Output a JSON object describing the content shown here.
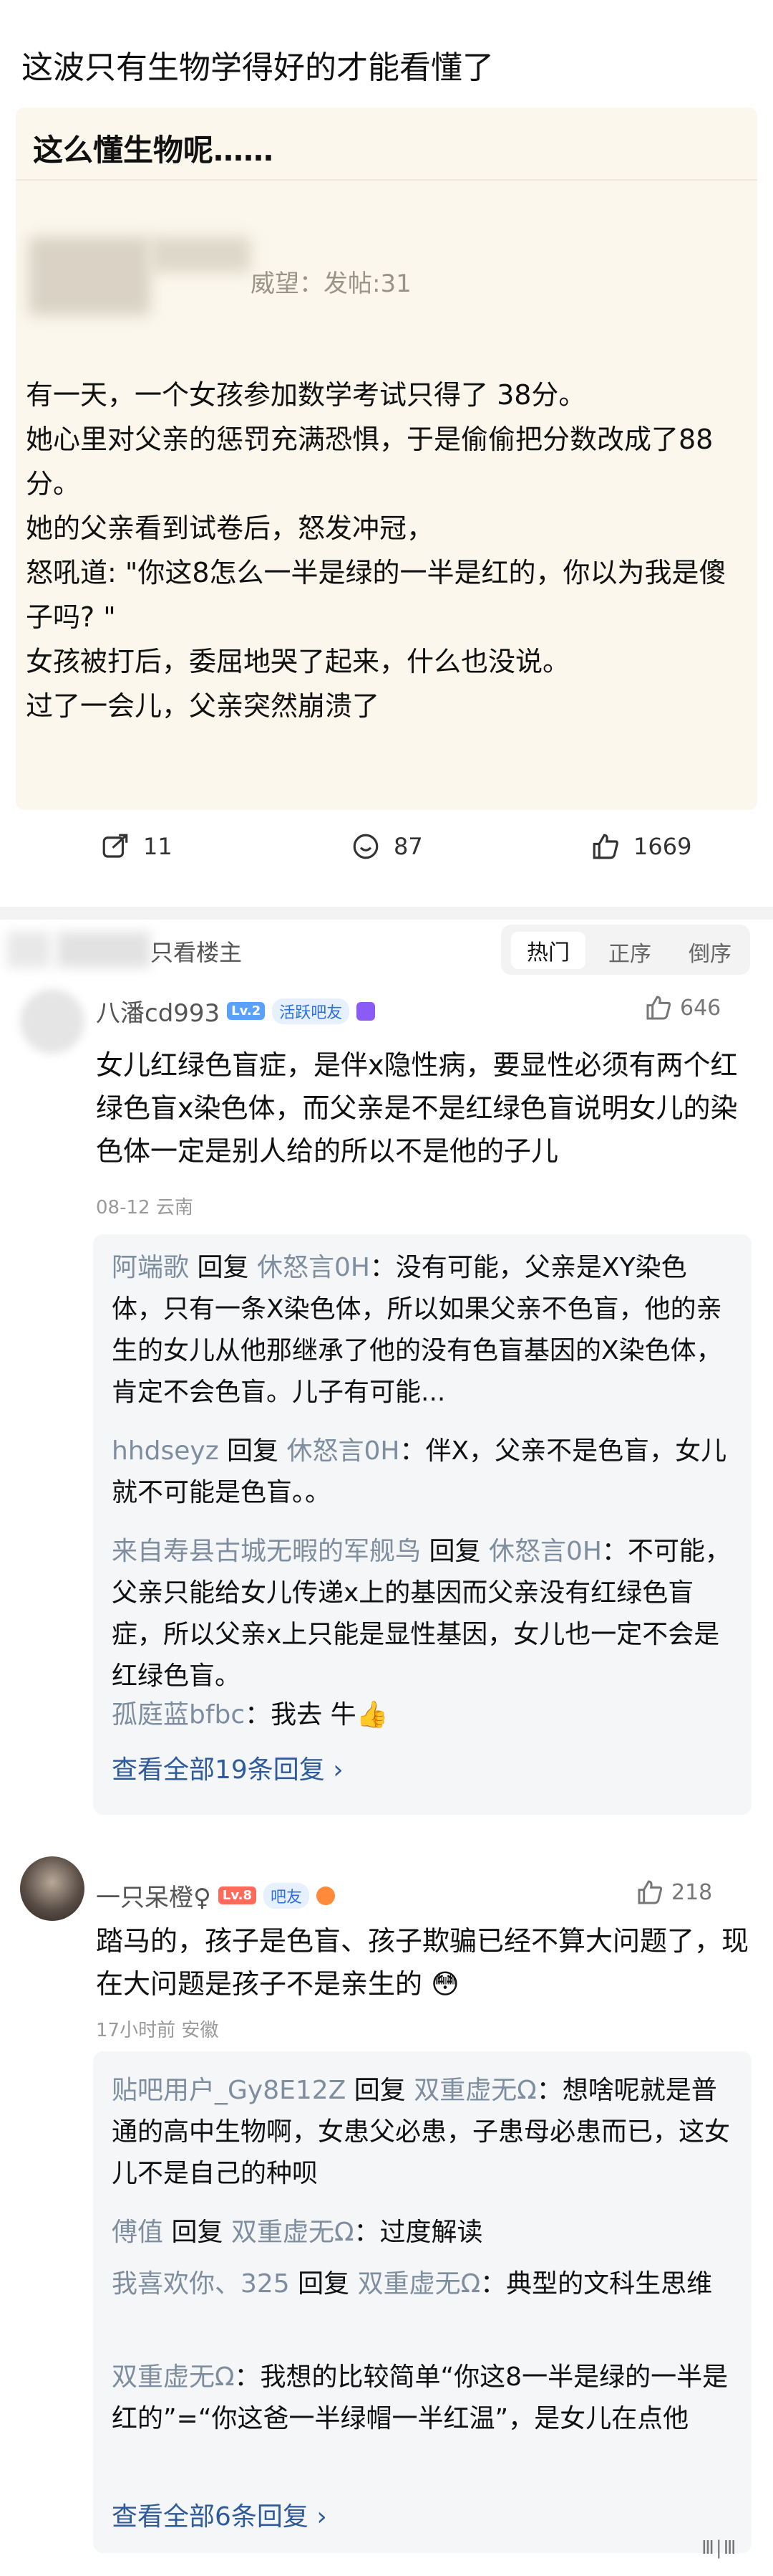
{
  "title": "这波只有生物学得好的才能看懂了",
  "card": {
    "heading": "这么懂生物呢……",
    "meta": "威望：发帖:31",
    "paragraphs": [
      "有一天，一个女孩参加数学考试只得了 38分。",
      "她心里对父亲的惩罚充满恐惧，于是偷偷把分数改成了88分。",
      "她的父亲看到试卷后，怒发冲冠，",
      "怒吼道: \"你这8怎么一半是绿的一半是红的，你以为我是傻子吗? \"",
      "女孩被打后，委屈地哭了起来，什么也没说。",
      "过了一会儿，父亲突然崩溃了"
    ]
  },
  "actions": {
    "share": "11",
    "comment": "87",
    "like": "1669"
  },
  "filter": {
    "label": "只看楼主",
    "sorts": [
      "热门",
      "正序",
      "倒序"
    ]
  },
  "comments": [
    {
      "name": "八潘cd993",
      "level": "Lv.2",
      "tag": "活跃吧友",
      "likes": "646",
      "text": "女儿红绿色盲症，是伴x隐性病，要显性必须有两个红绿色盲x染色体，而父亲是不是红绿色盲说明女儿的染色体一定是别人给的所以不是他的子儿",
      "meta": "08-12 云南",
      "replies": [
        {
          "name": "阿端歌",
          "reply": "回复",
          "target": "休怒言0H",
          "text": "：没有可能，父亲是XY染色体，只有一条X染色体，所以如果父亲不色盲，他的亲生的女儿从他那继承了他的没有色盲基因的X染色体，肯定不会色盲。儿子有可能..."
        },
        {
          "name": "hhdseyz",
          "reply": "回复",
          "target": "休怒言0H",
          "text": "：伴X，父亲不是色盲，女儿就不可能是色盲。。"
        },
        {
          "name": "来自寿县古城无暇的军舰鸟",
          "reply": "回复",
          "target": "休怒言0H",
          "text": "：不可能，父亲只能给女儿传递x上的基因而父亲没有红绿色盲症，所以父亲x上只能是显性基因，女儿也一定不会是红绿色盲。"
        },
        {
          "name": "孤庭蓝bfbc",
          "reply": "",
          "target": "",
          "text": "：我去 牛👍"
        }
      ],
      "view_all": "查看全部19条回复 ›"
    },
    {
      "name": "一只呆橙♀",
      "level": "Lv.8",
      "tag": "吧友",
      "likes": "218",
      "text": "踏马的，孩子是色盲、孩子欺骗已经不算大问题了，现在大问题是孩子不是亲生的 😳",
      "meta": "17小时前 安徽",
      "replies": [
        {
          "name": "贴吧用户_Gy8E12Z",
          "reply": "回复",
          "target": "双重虚无Ω",
          "text": "：想啥呢就是普通的高中生物啊，女患父必患，子患母必患而已，这女儿不是自己的种呗"
        },
        {
          "name": "傅值",
          "reply": "回复",
          "target": "双重虚无Ω",
          "text": "：过度解读"
        },
        {
          "name": "我喜欢你、325",
          "reply": "回复",
          "target": "双重虚无Ω",
          "text": "：典型的文科生思维"
        },
        {
          "name": "双重虚无Ω",
          "reply": "",
          "target": "",
          "text": "：我想的比较简单“你这8一半是绿的一半是红的”=“你这爸一半绿帽一半红温”，是女儿在点他"
        }
      ],
      "view_all": "查看全部6条回复 ›"
    }
  ],
  "watermark": "Ⅲ|Ⅲ"
}
